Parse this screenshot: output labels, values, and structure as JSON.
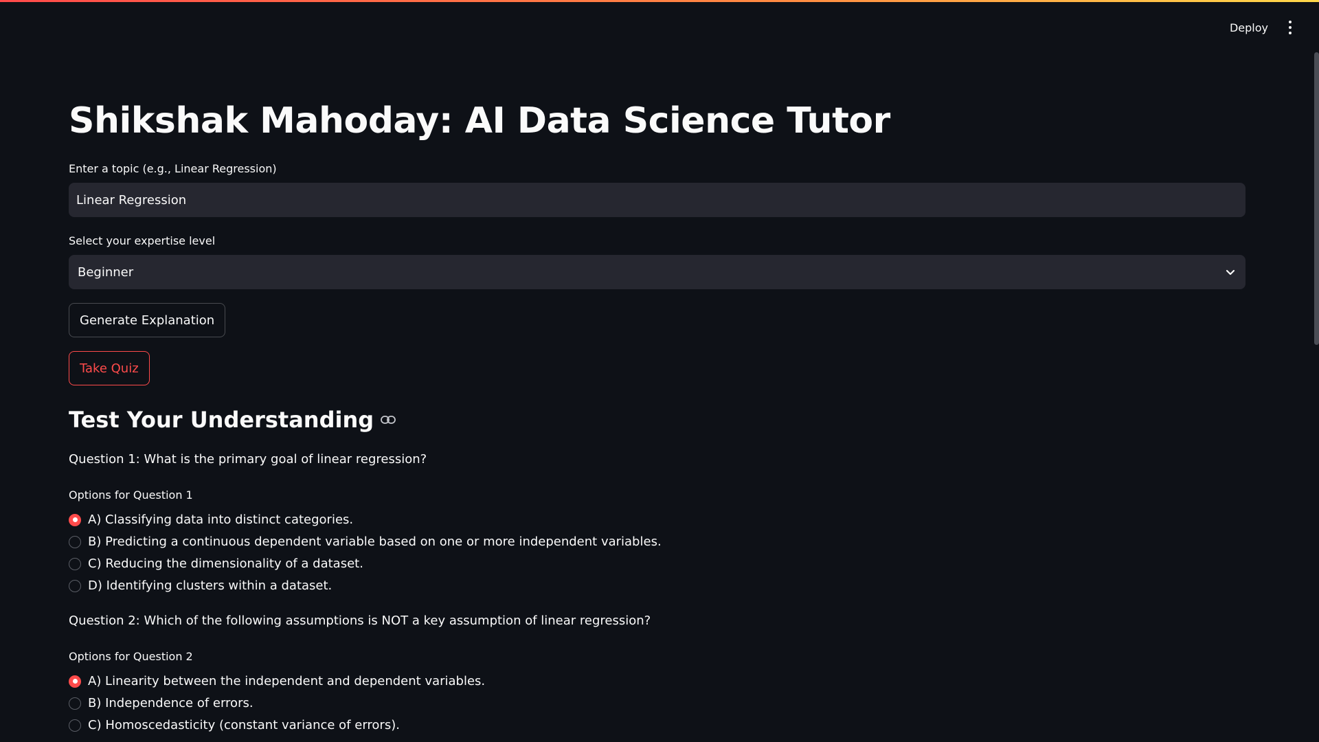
{
  "app": {
    "deploy_label": "Deploy",
    "title": "Shikshak Mahoday: AI Data Science Tutor"
  },
  "topic": {
    "label": "Enter a topic (e.g., Linear Regression)",
    "value": "Linear Regression"
  },
  "expertise": {
    "label": "Select your expertise level",
    "selected": "Beginner"
  },
  "buttons": {
    "generate": "Generate Explanation",
    "quiz": "Take Quiz"
  },
  "quiz": {
    "heading": "Test Your Understanding",
    "questions": [
      {
        "text": "Question 1: What is the primary goal of linear regression?",
        "options_label": "Options for Question 1",
        "options": [
          {
            "label": "A) Classifying data into distinct categories.",
            "selected": true
          },
          {
            "label": "B) Predicting a continuous dependent variable based on one or more independent variables.",
            "selected": false
          },
          {
            "label": "C) Reducing the dimensionality of a dataset.",
            "selected": false
          },
          {
            "label": "D) Identifying clusters within a dataset.",
            "selected": false
          }
        ]
      },
      {
        "text": "Question 2: Which of the following assumptions is NOT a key assumption of linear regression?",
        "options_label": "Options for Question 2",
        "options": [
          {
            "label": "A) Linearity between the independent and dependent variables.",
            "selected": true
          },
          {
            "label": "B) Independence of errors.",
            "selected": false
          },
          {
            "label": "C) Homoscedasticity (constant variance of errors).",
            "selected": false
          }
        ]
      }
    ]
  },
  "colors": {
    "background": "#0e1117",
    "input_bg": "#262730",
    "accent": "#ff4b4b",
    "text": "#fafafa"
  },
  "icons": {
    "menu": "vertical-ellipsis-icon",
    "select": "chevron-down-icon",
    "anchor": "link-icon",
    "radio": "radio-icon"
  }
}
